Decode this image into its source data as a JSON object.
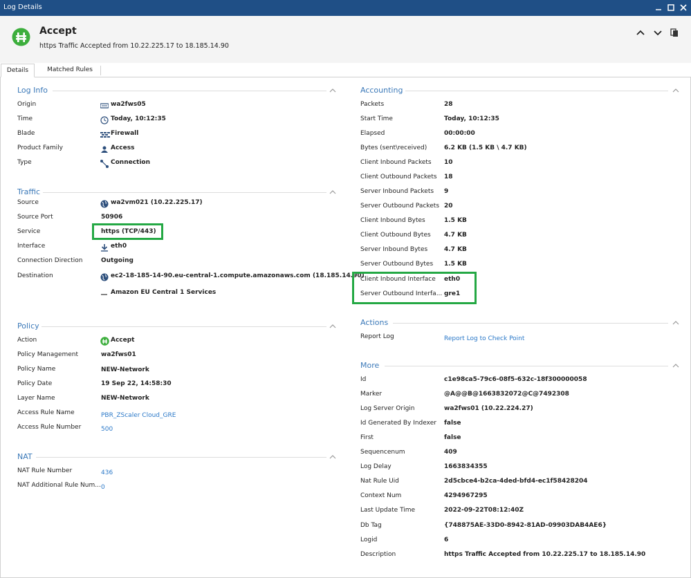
{
  "window": {
    "title": "Log Details"
  },
  "header": {
    "title": "Accept",
    "subtitle": "https Traffic Accepted from 10.22.225.17 to 18.185.14.90"
  },
  "tabs": [
    {
      "label": "Details",
      "active": true
    },
    {
      "label": "Matched Rules",
      "active": false
    }
  ],
  "log_info": {
    "title": "Log Info",
    "rows": [
      {
        "label": "Origin",
        "value": "wa2fws05",
        "icon": "gateway-icon"
      },
      {
        "label": "Time",
        "value": "Today, 10:12:35",
        "icon": "clock-icon"
      },
      {
        "label": "Blade",
        "value": "Firewall",
        "icon": "firewall-icon"
      },
      {
        "label": "Product Family",
        "value": "Access",
        "icon": "access-icon"
      },
      {
        "label": "Type",
        "value": "Connection",
        "icon": "connection-icon"
      }
    ]
  },
  "traffic": {
    "title": "Traffic",
    "rows": [
      {
        "label": "Source",
        "value": "wa2vm021 (10.22.225.17)",
        "icon": "globe-icon"
      },
      {
        "label": "Source Port",
        "value": "50906"
      },
      {
        "label": "Service",
        "value": "https (TCP/443)"
      },
      {
        "label": "Interface",
        "value": "eth0",
        "icon": "arrow-down-icon"
      },
      {
        "label": "Connection Direction",
        "value": "Outgoing"
      },
      {
        "label": "Destination",
        "value": "ec2-18-185-14-90.eu-central-1.compute.amazonaws.com (18.185.14.90)",
        "icon": "globe-icon"
      }
    ],
    "destination_extra": "Amazon EU Central 1 Services"
  },
  "policy": {
    "title": "Policy",
    "rows": [
      {
        "label": "Action",
        "value": "Accept",
        "icon": "accept-icon"
      },
      {
        "label": "Policy Management",
        "value": "wa2fws01"
      },
      {
        "label": "Policy Name",
        "value": "NEW-Network"
      },
      {
        "label": "Policy Date",
        "value": "19 Sep 22, 14:58:30"
      },
      {
        "label": "Layer Name",
        "value": "NEW-Network"
      },
      {
        "label": "Access Rule Name",
        "value": "PBR_ZScaler Cloud_GRE",
        "link": true
      },
      {
        "label": "Access Rule Number",
        "value": "500",
        "link": true
      }
    ]
  },
  "nat": {
    "title": "NAT",
    "rows": [
      {
        "label": "NAT Rule Number",
        "value": "436",
        "link": true
      },
      {
        "label": "NAT Additional Rule Num...",
        "value": "0",
        "link": true
      }
    ]
  },
  "accounting": {
    "title": "Accounting",
    "rows": [
      {
        "label": "Packets",
        "value": "28"
      },
      {
        "label": "Start Time",
        "value": "Today, 10:12:35"
      },
      {
        "label": "Elapsed",
        "value": "00:00:00"
      },
      {
        "label": "Bytes (sent\\received)",
        "value": "6.2 KB (1.5 KB \\ 4.7 KB)"
      },
      {
        "label": "Client Inbound Packets",
        "value": "10"
      },
      {
        "label": "Client Outbound Packets",
        "value": "18"
      },
      {
        "label": "Server Inbound Packets",
        "value": "9"
      },
      {
        "label": "Server Outbound Packets",
        "value": "20"
      },
      {
        "label": "Client Inbound Bytes",
        "value": "1.5 KB"
      },
      {
        "label": "Client Outbound Bytes",
        "value": "4.7 KB"
      },
      {
        "label": "Server Inbound Bytes",
        "value": "4.7 KB"
      },
      {
        "label": "Server Outbound Bytes",
        "value": "1.5 KB"
      },
      {
        "label": "Client Inbound Interface",
        "value": "eth0"
      },
      {
        "label": "Server Outbound Interfa...",
        "value": "gre1"
      }
    ]
  },
  "actions": {
    "title": "Actions",
    "rows": [
      {
        "label": "Report Log",
        "value": "Report Log to Check Point",
        "link": true
      }
    ]
  },
  "more": {
    "title": "More",
    "rows": [
      {
        "label": "Id",
        "value": "c1e98ca5-79c6-08f5-632c-18f300000058"
      },
      {
        "label": "Marker",
        "value": "@A@@B@1663832072@C@7492308"
      },
      {
        "label": "Log Server Origin",
        "value": "wa2fws01 (10.22.224.27)"
      },
      {
        "label": "Id Generated By Indexer",
        "value": "false"
      },
      {
        "label": "First",
        "value": "false"
      },
      {
        "label": "Sequencenum",
        "value": "409"
      },
      {
        "label": "Log Delay",
        "value": "1663834355"
      },
      {
        "label": "Nat Rule Uid",
        "value": "2d5cbce4-b2ca-4ded-bfd4-ec1f58428204"
      },
      {
        "label": "Context Num",
        "value": "4294967295"
      },
      {
        "label": "Last Update Time",
        "value": "2022-09-22T08:12:40Z"
      },
      {
        "label": "Db Tag",
        "value": "{748875AE-33D0-8942-81AD-09903DAB4AE6}"
      },
      {
        "label": "Logid",
        "value": "6"
      },
      {
        "label": "Description",
        "value": "https Traffic Accepted from 10.22.225.17 to 18.185.14.90"
      }
    ]
  },
  "colors": {
    "titlebar": "#1f4f86",
    "section_title": "#3a78b8",
    "link": "#2a78c8",
    "accept_green": "#3cae3c",
    "highlight": "#24a844"
  }
}
